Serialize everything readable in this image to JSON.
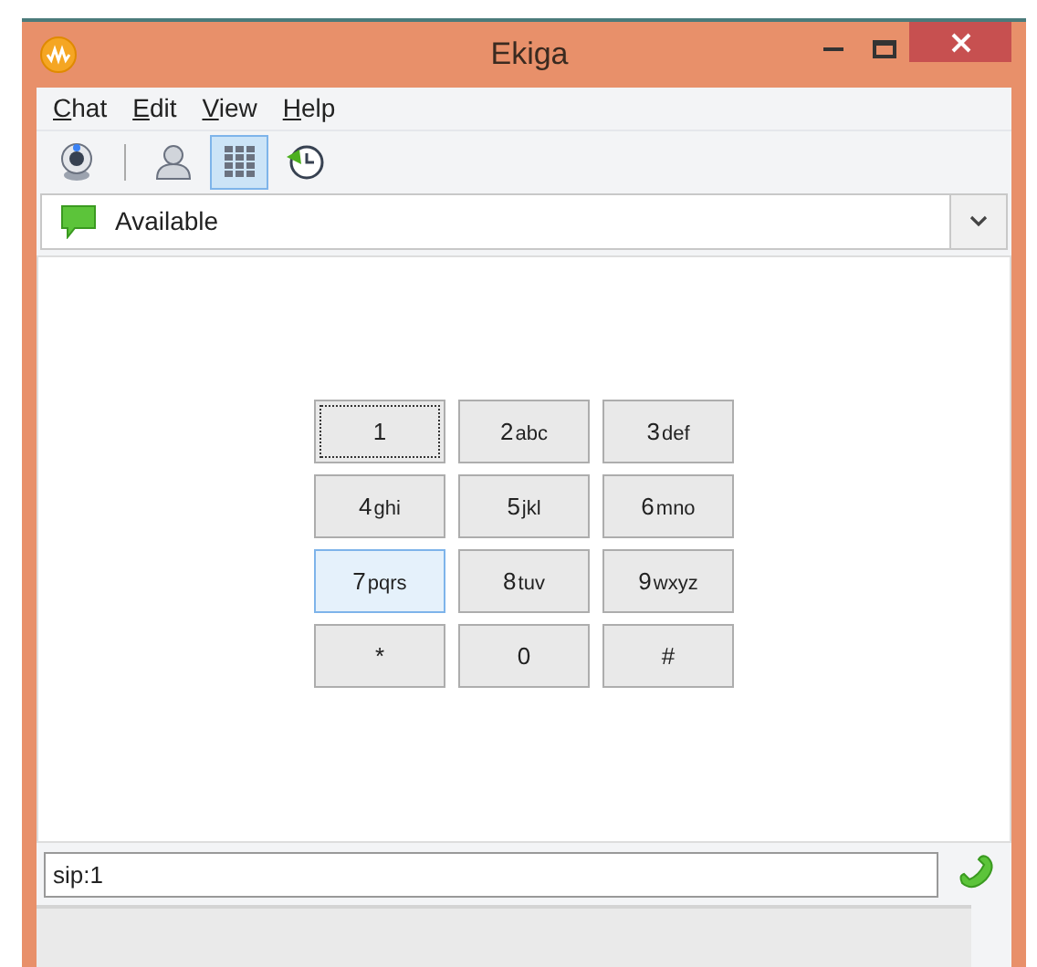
{
  "window": {
    "title": "Ekiga"
  },
  "menu": [
    {
      "label": "Chat"
    },
    {
      "label": "Edit"
    },
    {
      "label": "View"
    },
    {
      "label": "Help"
    }
  ],
  "toolbar": [
    {
      "kind": "webcam",
      "selected": false
    },
    {
      "kind": "separator"
    },
    {
      "kind": "contacts",
      "selected": false
    },
    {
      "kind": "dialpad",
      "selected": true
    },
    {
      "kind": "history",
      "selected": false
    }
  ],
  "presence": {
    "label": "Available"
  },
  "keypad": [
    {
      "digit": "1",
      "focused": true,
      "hovered": false
    },
    {
      "digit": "2",
      "letters": "abc",
      "focused": false,
      "hovered": false
    },
    {
      "digit": "3",
      "letters": "def",
      "focused": false,
      "hovered": false
    },
    {
      "digit": "4",
      "letters": "ghi",
      "focused": false,
      "hovered": false
    },
    {
      "digit": "5",
      "letters": "jkl",
      "focused": false,
      "hovered": false
    },
    {
      "digit": "6",
      "letters": "mno",
      "focused": false,
      "hovered": false
    },
    {
      "digit": "7",
      "letters": "pqrs",
      "focused": false,
      "hovered": true
    },
    {
      "digit": "8",
      "letters": "tuv",
      "focused": false,
      "hovered": false
    },
    {
      "digit": "9",
      "letters": "wxyz",
      "focused": false,
      "hovered": false
    },
    {
      "digit": "*",
      "focused": false,
      "hovered": false
    },
    {
      "digit": "0",
      "focused": false,
      "hovered": false
    },
    {
      "digit": "#",
      "focused": false,
      "hovered": false
    }
  ],
  "address": {
    "value": "sip:1"
  }
}
